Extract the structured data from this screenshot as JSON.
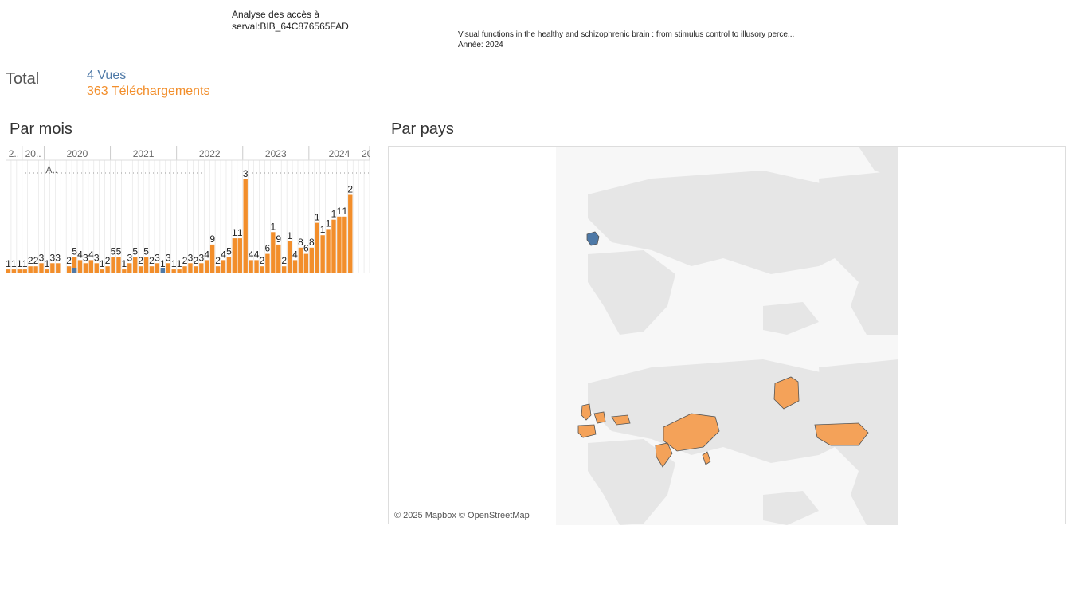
{
  "header": {
    "title": "Analyse des accès à\n serval:BIB_64C876565FAD",
    "doc_title": "Visual functions in the healthy and schizophrenic brain : from stimulus control to illusory perce...",
    "doc_year": "Année: 2024"
  },
  "totals": {
    "label": "Total",
    "views": "4 Vues",
    "downloads": "363 Téléchargements"
  },
  "sections": {
    "by_month": "Par mois",
    "by_country": "Par pays"
  },
  "map": {
    "credit": "© 2025 Mapbox © OpenStreetMap",
    "views_countries": [
      "France"
    ],
    "download_countries": [
      "United Kingdom",
      "Ireland",
      "Spain",
      "Portugal",
      "Germany",
      "Netherlands",
      "Czechia",
      "Hungary",
      "Romania",
      "China",
      "India",
      "Philippines",
      "United States",
      "Alaska"
    ]
  },
  "colors": {
    "views": "#4e79a7",
    "downloads": "#f28e2b",
    "land": "#e6e6e6",
    "text": "#333333"
  },
  "chart_data": {
    "type": "bar",
    "year_headers": [
      "2..",
      "20..",
      "2020",
      "2021",
      "2022",
      "2023",
      "2024",
      "2025"
    ],
    "annotation": "A..",
    "series": [
      {
        "name": "Vues",
        "values": [
          0,
          0,
          0,
          0,
          0,
          0,
          0,
          0,
          0,
          0,
          0,
          0,
          1,
          0,
          0,
          0,
          0,
          0,
          0,
          0,
          0,
          0,
          0,
          0,
          0,
          0,
          0,
          0,
          1,
          0,
          0,
          0,
          0,
          0,
          0,
          0,
          0,
          0,
          0,
          0,
          0,
          0,
          0,
          0,
          0,
          0,
          0,
          0,
          0,
          0,
          0,
          0,
          0,
          0,
          0,
          0,
          0,
          0,
          0,
          0,
          0,
          0,
          0,
          0,
          0,
          0
        ]
      },
      {
        "name": "Téléchargements",
        "values": [
          1,
          1,
          1,
          1,
          2,
          2,
          3,
          1,
          3,
          3,
          0,
          2,
          5,
          4,
          3,
          4,
          3,
          1,
          2,
          5,
          5,
          1,
          3,
          5,
          2,
          5,
          2,
          3,
          1,
          3,
          1,
          1,
          2,
          3,
          2,
          3,
          4,
          9,
          2,
          4,
          5,
          11,
          11,
          30,
          4,
          4,
          2,
          6,
          13,
          9,
          2,
          10,
          4,
          8,
          6,
          8,
          16,
          12,
          14,
          17,
          18,
          18,
          25,
          0,
          0,
          0
        ]
      },
      {
        "name": "labels",
        "values": [
          "1",
          "1",
          "1",
          "1",
          "2",
          "2",
          "3",
          "1",
          "3",
          "3",
          "",
          "2",
          "5",
          "4",
          "3",
          "4",
          "3",
          "1",
          "2",
          "5",
          "5",
          "1",
          "3",
          "5",
          "2",
          "5",
          "2",
          "3",
          "1",
          "3",
          "1",
          "1",
          "2",
          "3",
          "2",
          "3",
          "4",
          "9",
          "2",
          "4",
          "5",
          "1",
          "1",
          "3",
          "4",
          "4",
          "2",
          "6",
          "1",
          "9",
          "2",
          "1",
          "4",
          "8",
          "6",
          "8",
          "1",
          "1",
          "1",
          "1",
          "1",
          "1",
          "2",
          "",
          "",
          ""
        ]
      }
    ]
  }
}
